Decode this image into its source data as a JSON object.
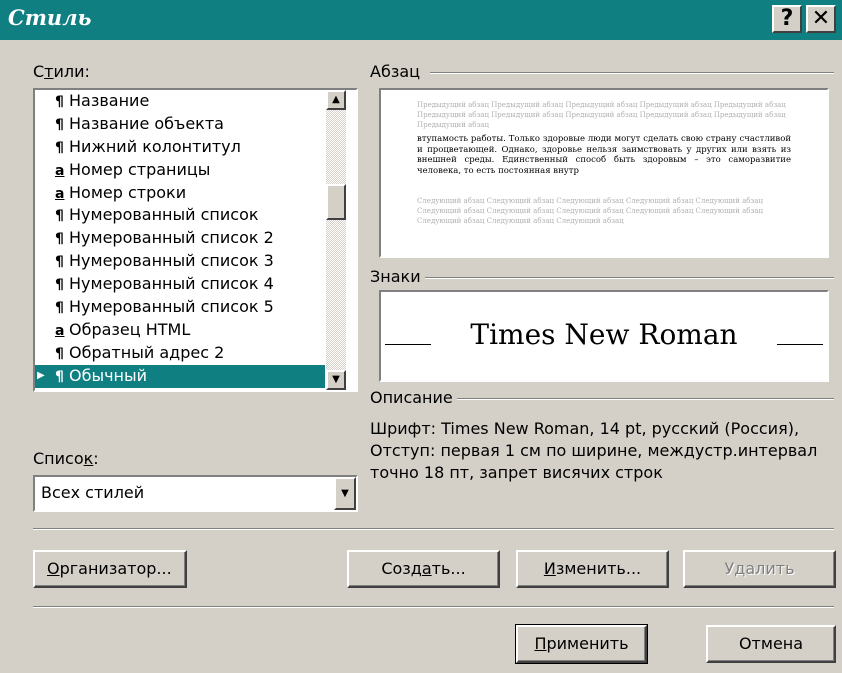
{
  "window": {
    "title": "Стиль",
    "help_button": "?",
    "close_button": "✕"
  },
  "styles_label": {
    "pre": "С",
    "acc": "т",
    "post": "или:"
  },
  "styles_list": [
    {
      "marker": "¶",
      "name": "Название"
    },
    {
      "marker": "¶",
      "name": "Название объекта"
    },
    {
      "marker": "¶",
      "name": "Нижний колонтитул"
    },
    {
      "marker": "a",
      "name": "Номер страницы"
    },
    {
      "marker": "a",
      "name": "Номер строки"
    },
    {
      "marker": "¶",
      "name": "Нумерованный список"
    },
    {
      "marker": "¶",
      "name": "Нумерованный список 2"
    },
    {
      "marker": "¶",
      "name": "Нумерованный список 3"
    },
    {
      "marker": "¶",
      "name": "Нумерованный список 4"
    },
    {
      "marker": "¶",
      "name": "Нумерованный список 5"
    },
    {
      "marker": "a",
      "name": "Образец HTML"
    },
    {
      "marker": "¶",
      "name": "Обратный адрес 2"
    },
    {
      "marker": "¶",
      "name": "Обычный",
      "selected": true
    }
  ],
  "paragraph_group": {
    "label": "Абзац",
    "ghost_before": "Предыдущий абзац Предыдущий абзац Предыдущий абзац Предыдущий абзац Предыдущий абзац Предыдущий абзац Предыдущий абзац Предыдущий абзац Предыдущий абзац Предыдущий абзац Предыдущий абзац",
    "sample_text": "втупамость работы. Только здоровые люди могут сделать свою страну счастливой и процветающей. Однако, здоровье нельзя заимствовать у других или взять из внешней среды. Единственный способ быть здоровым – это саморазвитие человека, то есть постоянная внутр",
    "ghost_after": "Следующий абзац Следующий абзац Следующий абзац Следующий абзац Следующий абзац Следующий абзац Следующий абзац Следующий абзац Следующий абзац Следующий абзац Следующий абзац Следующий абзац Следующий абзац"
  },
  "characters_group": {
    "label": "Знаки",
    "font_sample": "Times New Roman"
  },
  "description_group": {
    "label": "Описание",
    "text": "Шрифт: Times New Roman, 14 pt, русский (Россия), Отступ: первая  1 см по ширине, междустр.интервал точно 18 пт, запрет висячих строк"
  },
  "list_label": {
    "pre": "Списо",
    "acc": "к",
    "post": ":"
  },
  "list_combo": {
    "value": "Всех стилей"
  },
  "buttons": {
    "organizer": {
      "acc": "О",
      "post": "рганизатор..."
    },
    "create": {
      "pre": "Созд",
      "acc": "а",
      "post": "ть..."
    },
    "modify": {
      "acc": "И",
      "post": "зменить..."
    },
    "delete": {
      "label": "Удалить",
      "disabled": true
    },
    "apply": {
      "acc": "П",
      "post": "рименить"
    },
    "cancel": {
      "label": "Отмена"
    }
  },
  "colors": {
    "title_bar": "#0f7f82",
    "selection": "#0f7f82",
    "dialog_bg": "#d4d0c8"
  }
}
